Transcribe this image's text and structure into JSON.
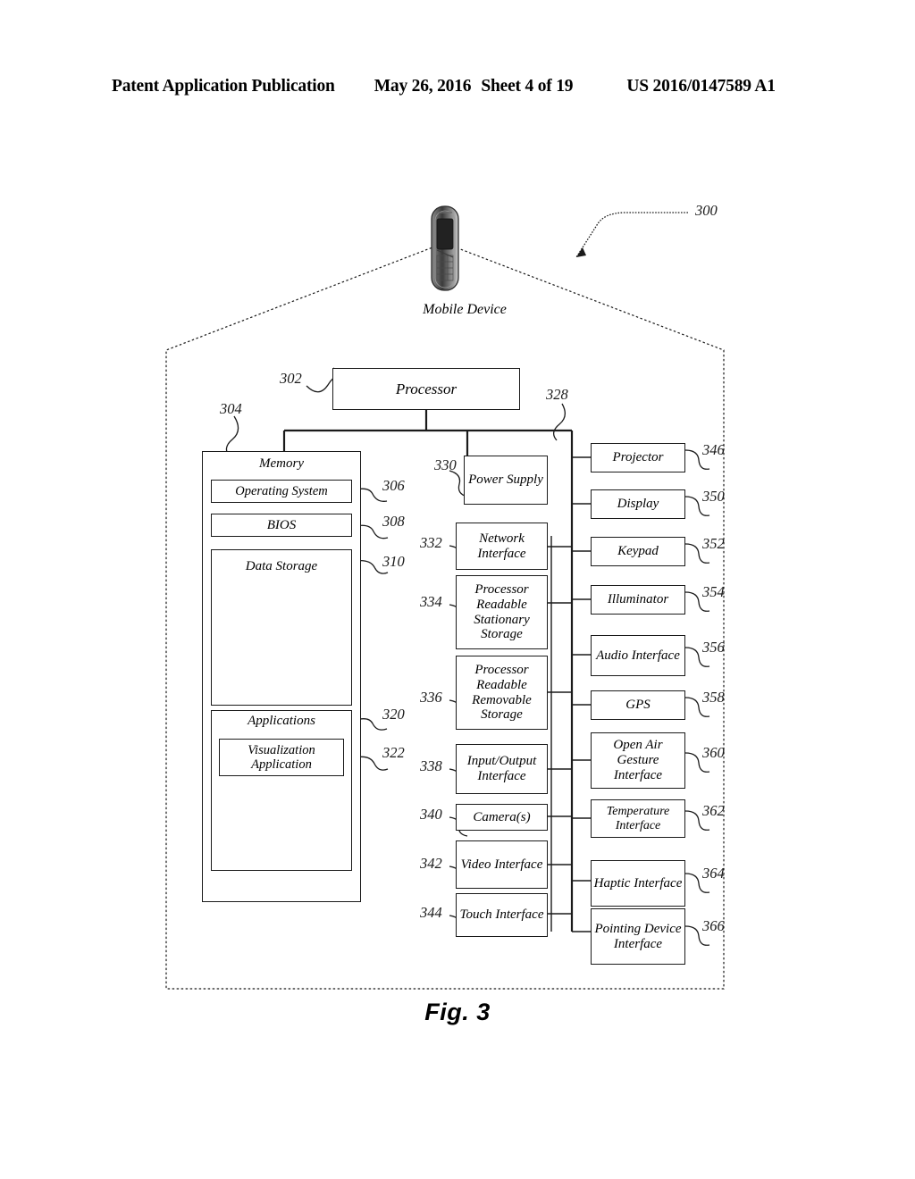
{
  "header": {
    "publication": "Patent Application Publication",
    "date": "May 26, 2016",
    "sheet": "Sheet 4 of 19",
    "patent_number": "US 2016/0147589 A1"
  },
  "figure": {
    "caption": "Fig. 3",
    "system_ref": "300",
    "device_caption": "Mobile Device"
  },
  "blocks": {
    "processor": {
      "label": "Processor",
      "ref": "302"
    },
    "memory": {
      "label": "Memory",
      "ref": "304"
    },
    "operating_system": {
      "label": "Operating System",
      "ref": "306"
    },
    "bios": {
      "label": "BIOS",
      "ref": "308"
    },
    "data_storage": {
      "label": "Data Storage",
      "ref": "310"
    },
    "applications": {
      "label": "Applications",
      "ref": "320"
    },
    "visualization_application": {
      "label": "Visualization Application",
      "ref": "322"
    },
    "bus": {
      "ref": "328"
    },
    "power_supply": {
      "label": "Power Supply",
      "ref": "330"
    },
    "network_interface": {
      "label": "Network Interface",
      "ref": "332"
    },
    "processor_readable_stationary_storage": {
      "label": "Processor Readable Stationary Storage",
      "ref": "334"
    },
    "processor_readable_removable_storage": {
      "label": "Processor Readable Removable Storage",
      "ref": "336"
    },
    "input_output_interface": {
      "label": "Input/Output Interface",
      "ref": "338"
    },
    "cameras": {
      "label": "Camera(s)",
      "ref": "340"
    },
    "video_interface": {
      "label": "Video Interface",
      "ref": "342"
    },
    "touch_interface": {
      "label": "Touch Interface",
      "ref": "344"
    },
    "projector": {
      "label": "Projector",
      "ref": "346"
    },
    "display": {
      "label": "Display",
      "ref": "350"
    },
    "keypad": {
      "label": "Keypad",
      "ref": "352"
    },
    "illuminator": {
      "label": "Illuminator",
      "ref": "354"
    },
    "audio_interface": {
      "label": "Audio Interface",
      "ref": "356"
    },
    "gps": {
      "label": "GPS",
      "ref": "358"
    },
    "open_air_gesture_interface": {
      "label": "Open Air Gesture Interface",
      "ref": "360"
    },
    "temperature_interface": {
      "label": "Temperature Interface",
      "ref": "362"
    },
    "haptic_interface": {
      "label": "Haptic Interface",
      "ref": "364"
    },
    "pointing_device_interface": {
      "label": "Pointing Device Interface",
      "ref": "366"
    }
  },
  "colors": {
    "ink": "#1a1a1a",
    "paper": "#ffffff"
  }
}
